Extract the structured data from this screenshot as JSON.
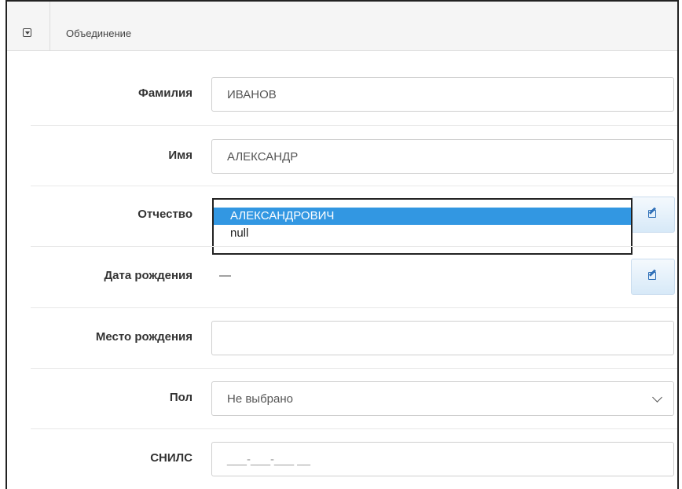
{
  "panel": {
    "title": "Объединение",
    "collapse_icon": "collapse-icon"
  },
  "fields": {
    "surname": {
      "label": "Фамилия",
      "value": "ИВАНОВ"
    },
    "name": {
      "label": "Имя",
      "value": "АЛЕКСАНДР"
    },
    "patronymic": {
      "label": "Отчество",
      "options": [
        "АЛЕКСАНДРОВИЧ",
        "null"
      ],
      "selected": "АЛЕКСАНДРОВИЧ",
      "edit_icon": "edit-icon"
    },
    "birth_date": {
      "label": "Дата рождения",
      "value": "—",
      "edit_icon": "edit-icon"
    },
    "birth_place": {
      "label": "Место рождения",
      "value": ""
    },
    "gender": {
      "label": "Пол",
      "value": "Не выбрано"
    },
    "snils": {
      "label": "СНИЛС",
      "placeholder": "___-___-___ __"
    }
  },
  "colors": {
    "highlight": "#3297e2",
    "edit_icon": "#2f70b8"
  }
}
